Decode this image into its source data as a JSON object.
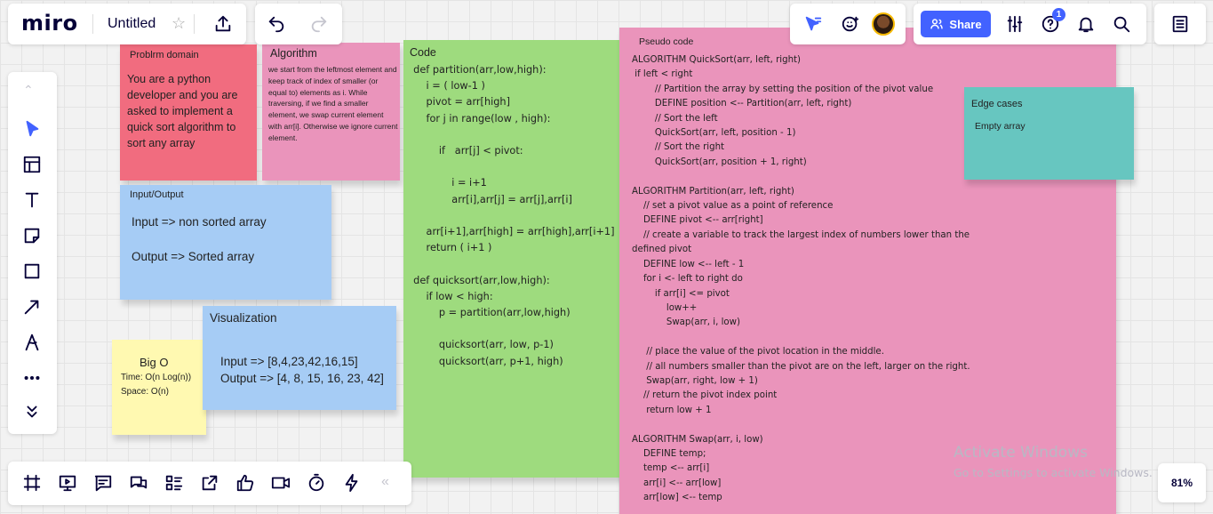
{
  "topbar": {
    "logo": "miro",
    "board_title": "Untitled",
    "share_label": "Share",
    "help_badge": "1"
  },
  "stickies": {
    "problem": {
      "title": "Problrm domain",
      "body": "You are a python developer and you are asked to implement a quick sort algorithm to sort any array",
      "color": "#f16c7f"
    },
    "algorithm": {
      "title": "Algorithm",
      "body": "we start from the leftmost element and keep track of index of smaller (or equal to) elements as i. While traversing, if we find a smaller element, we swap current element with arr[i]. Otherwise we ignore current element.",
      "color": "#ea94bb"
    },
    "io": {
      "title": "Input/Output",
      "input": "Input => non sorted array",
      "output": "Output => Sorted array",
      "color": "#a6ccf5"
    },
    "visualization": {
      "title": "Visualization",
      "input": "Input => [8,4,23,42,16,15]",
      "output": "Output => [4, 8, 15, 16, 23, 42]",
      "color": "#a6ccf5"
    },
    "bigo": {
      "title": "Big O",
      "time": "Time: O(n Log(n))",
      "space": "Space: O(n)",
      "color": "#fff9b1"
    },
    "code": {
      "title": "Code",
      "body": "  def partition(arr,low,high):\n      i = ( low-1 )\n      pivot = arr[high]\n      for j in range(low , high):\n\n          if   arr[j] < pivot:\n\n              i = i+1\n              arr[i],arr[j] = arr[j],arr[i]\n\n      arr[i+1],arr[high] = arr[high],arr[i+1]\n      return ( i+1 )\n\n  def quicksort(arr,low,high):\n      if low < high:\n          p = partition(arr,low,high)\n\n          quicksort(arr, low, p-1)\n          quicksort(arr, p+1, high)",
      "color": "#9edb7e"
    },
    "pseudo": {
      "title": "Pseudo code",
      "body": "ALGORITHM QuickSort(arr, left, right)\n if left < right\n        // Partition the array by setting the position of the pivot value\n        DEFINE position <-- Partition(arr, left, right)\n        // Sort the left\n        QuickSort(arr, left, position - 1)\n        // Sort the right\n        QuickSort(arr, position + 1, right)\n\nALGORITHM Partition(arr, left, right)\n    // set a pivot value as a point of reference\n    DEFINE pivot <-- arr[right]\n    // create a variable to track the largest index of numbers lower than the\ndefined pivot\n    DEFINE low <-- left - 1\n    for i <- left to right do\n        if arr[i] <= pivot\n            low++\n            Swap(arr, i, low)\n\n     // place the value of the pivot location in the middle.\n     // all numbers smaller than the pivot are on the left, larger on the right.\n     Swap(arr, right, low + 1)\n    // return the pivot index point\n     return low + 1\n\nALGORITHM Swap(arr, i, low)\n    DEFINE temp;\n    temp <-- arr[i]\n    arr[i] <-- arr[low]\n    arr[low] <-- temp",
      "color": "#ea94bb"
    },
    "edge": {
      "title": "Edge cases",
      "body": "Empty array",
      "color": "#67c6c0"
    }
  },
  "watermark": {
    "title": "Activate Windows",
    "subtitle": "Go to Settings to activate Windows."
  },
  "zoom": "81%",
  "colors": {
    "accent": "#4262ff"
  }
}
